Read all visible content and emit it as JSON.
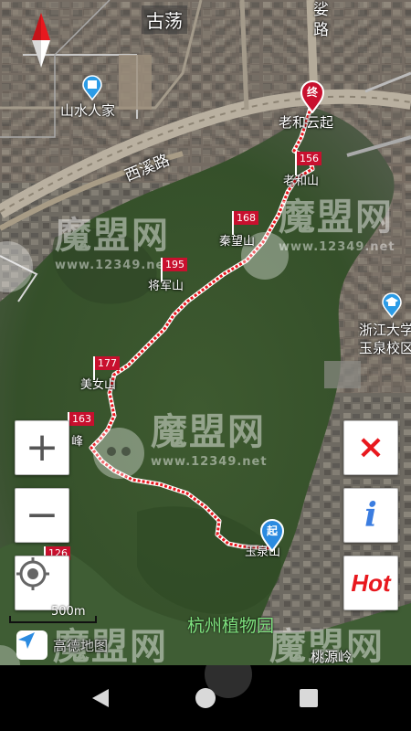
{
  "map": {
    "places": {
      "gudang": "古荡",
      "shanshui": "山水人家",
      "xixi_road": "西溪路",
      "road_top": "路",
      "road_top_partial": "娑",
      "laohe_yunqi": "老和云起",
      "laohe_shan": "老和山",
      "qinwang_shan": "秦望山",
      "jiangjun_shan": "将军山",
      "meinu_shan": "美女山",
      "feng": "峰",
      "yuquan_shan": "玉泉山",
      "zju_line1": "浙江大学",
      "zju_line2": "玉泉校区",
      "botanical_garden": "杭州植物园",
      "taoyuan_ling": "桃源岭",
      "gaode": "高德地图"
    },
    "markers": {
      "start": "起",
      "end": "终"
    },
    "elevation_flags": [
      {
        "value": "156"
      },
      {
        "value": "168"
      },
      {
        "value": "195"
      },
      {
        "value": "177"
      },
      {
        "value": "163"
      },
      {
        "value": "126"
      }
    ],
    "scale_bar": "500m",
    "watermark": {
      "text": "魔盟网",
      "url": "www.12349.net"
    }
  },
  "controls": {
    "zoom_in": "+",
    "zoom_out": "−",
    "close": "×",
    "info": "i",
    "hot": "Hot"
  },
  "colors": {
    "route": "#e8181e",
    "flag": "#c8102e",
    "control_red": "#e8181e",
    "control_blue": "#3b7de0",
    "poi_blue": "#2b9be6"
  }
}
